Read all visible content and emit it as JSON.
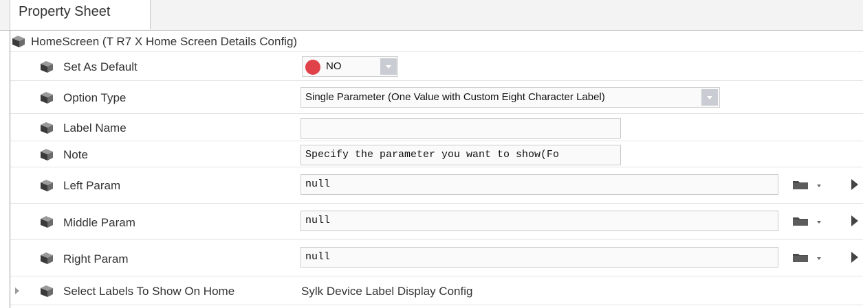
{
  "tab": {
    "label": "Property Sheet"
  },
  "root": {
    "label": "HomeScreen  (T R7 X Home Screen Details Config)"
  },
  "rows": {
    "set_as_default": {
      "label": "Set As Default",
      "value": "NO"
    },
    "option_type": {
      "label": "Option Type",
      "value": "Single Parameter (One Value with Custom Eight Character Label)"
    },
    "label_name": {
      "label": "Label Name",
      "value": ""
    },
    "note": {
      "label": "Note",
      "value": "Specify the parameter you want to show(Fo"
    },
    "left_param": {
      "label": "Left Param",
      "value": "null"
    },
    "middle_param": {
      "label": "Middle Param",
      "value": "null"
    },
    "right_param": {
      "label": "Right Param",
      "value": "null"
    },
    "select_labels": {
      "label": "Select Labels To Show On Home",
      "value": "Sylk Device Label Display Config"
    }
  },
  "colors": {
    "status_red": "#e0424a",
    "combo_arrow": "#c9cdd3",
    "tab_background": "#f3f3f3"
  },
  "icons": [
    "component-cube-icon",
    "red-status-dot-icon",
    "folder-icon",
    "chevron-down-icon",
    "play-arrow-icon",
    "expand-arrow-icon"
  ]
}
